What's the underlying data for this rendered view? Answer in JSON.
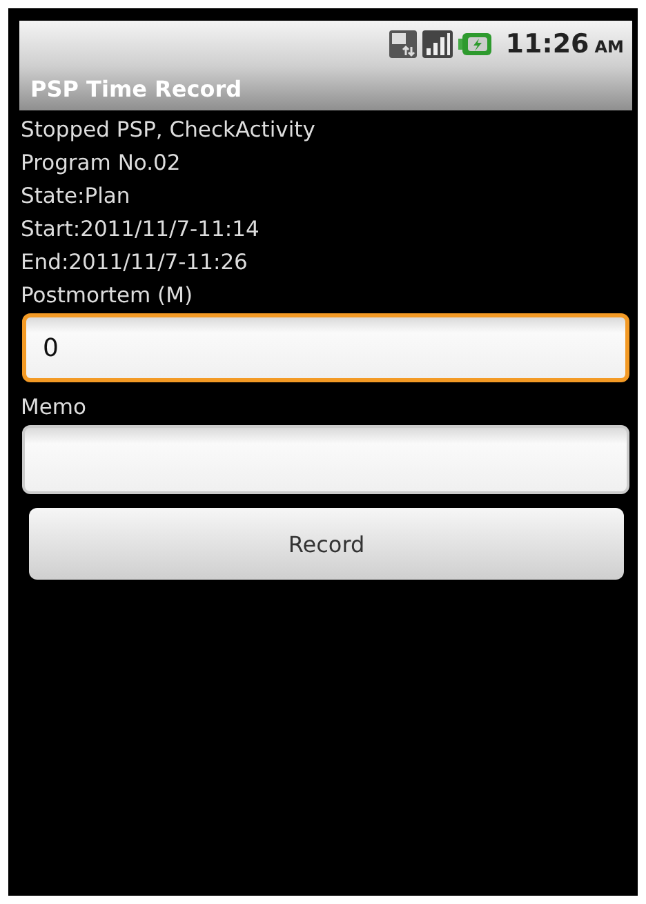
{
  "status_bar": {
    "time": "11:26",
    "meridiem": "AM"
  },
  "title_bar": {
    "title": "PSP Time Record"
  },
  "info_lines": [
    "Stopped PSP, CheckActivity",
    "Program No.02",
    "State:Plan",
    "Start:2011/11/7-11:14",
    "End:2011/11/7-11:26"
  ],
  "fields": [
    {
      "label": "Postmortem (M)",
      "value": "0",
      "focused": true
    },
    {
      "label": "Memo",
      "focused": false
    }
  ],
  "button": {
    "label": "Record"
  }
}
